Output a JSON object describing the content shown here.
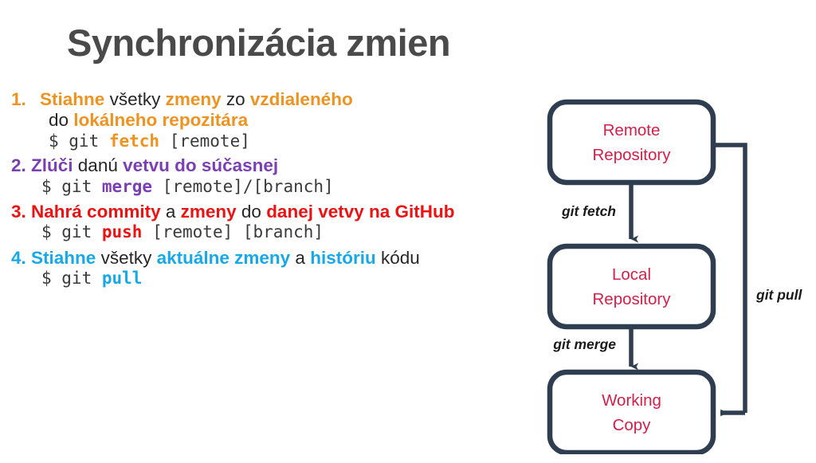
{
  "slide": {
    "title": "Synchronizácia zmien",
    "background": "#ffffff",
    "title_color": "#4a4a4a"
  },
  "colors": {
    "orange": "#ef9320",
    "purple": "#7b3fb5",
    "red": "#ee1111",
    "cyan": "#16a8e8",
    "navy": "#2e3e50",
    "crimson": "#d41f48",
    "text_dark": "#262626"
  },
  "steps": [
    {
      "number": "1.",
      "accent": "#ef9320",
      "line1": [
        {
          "t": "Stiahne",
          "hl": true
        },
        {
          "t": " všetky ",
          "hl": false
        },
        {
          "t": "zmeny",
          "hl": true
        },
        {
          "t": " zo ",
          "hl": false
        },
        {
          "t": "vzdialeného",
          "hl": true
        }
      ],
      "line2": [
        {
          "t": "do ",
          "hl": false
        },
        {
          "t": "lokálneho repozitára",
          "hl": true
        }
      ],
      "code": {
        "prompt": "$ git ",
        "command": "fetch",
        "args": " [remote]"
      }
    },
    {
      "number": "2.",
      "accent": "#7b3fb5",
      "line1": [
        {
          "t": "Zlúči",
          "hl": true
        },
        {
          "t": " danú ",
          "hl": false
        },
        {
          "t": "vetvu do súčasnej",
          "hl": true
        }
      ],
      "line2": [],
      "code": {
        "prompt": "$ git ",
        "command": "merge",
        "args": " [remote]/[branch]"
      }
    },
    {
      "number": "3.",
      "accent": "#ee1111",
      "line1": [
        {
          "t": "Nahrá commity",
          "hl": true
        },
        {
          "t": " a ",
          "hl": false
        },
        {
          "t": "zmeny",
          "hl": true
        },
        {
          "t": " do ",
          "hl": false
        },
        {
          "t": "danej vetvy na GitHub",
          "hl": true
        }
      ],
      "line2": [],
      "code": {
        "prompt": "$ git ",
        "command": "push",
        "args": " [remote] [branch]"
      }
    },
    {
      "number": "4.",
      "accent": "#16a8e8",
      "line1": [
        {
          "t": "Stiahne",
          "hl": true
        },
        {
          "t": " všetky ",
          "hl": false
        },
        {
          "t": "aktuálne zmeny",
          "hl": true
        },
        {
          "t": " a ",
          "hl": false
        },
        {
          "t": "históriu",
          "hl": true
        },
        {
          "t": " kódu",
          "hl": false
        }
      ],
      "line2": [],
      "code": {
        "prompt": "$ git ",
        "command": "pull",
        "args": ""
      }
    }
  ],
  "diagram": {
    "nodes": [
      {
        "id": "remote",
        "line1": "Remote",
        "line2": "Repository"
      },
      {
        "id": "local",
        "line1": "Local",
        "line2": "Repository"
      },
      {
        "id": "working",
        "line1": "Working",
        "line2": "Copy"
      }
    ],
    "edges": [
      {
        "id": "fetch",
        "label": "git fetch",
        "from": "remote",
        "to": "local"
      },
      {
        "id": "merge",
        "label": "git merge",
        "from": "local",
        "to": "working"
      },
      {
        "id": "pull",
        "label": "git pull",
        "from": "remote",
        "to": "working"
      }
    ],
    "stroke_color": "#2e3e50",
    "label_color": "#d41f48"
  }
}
